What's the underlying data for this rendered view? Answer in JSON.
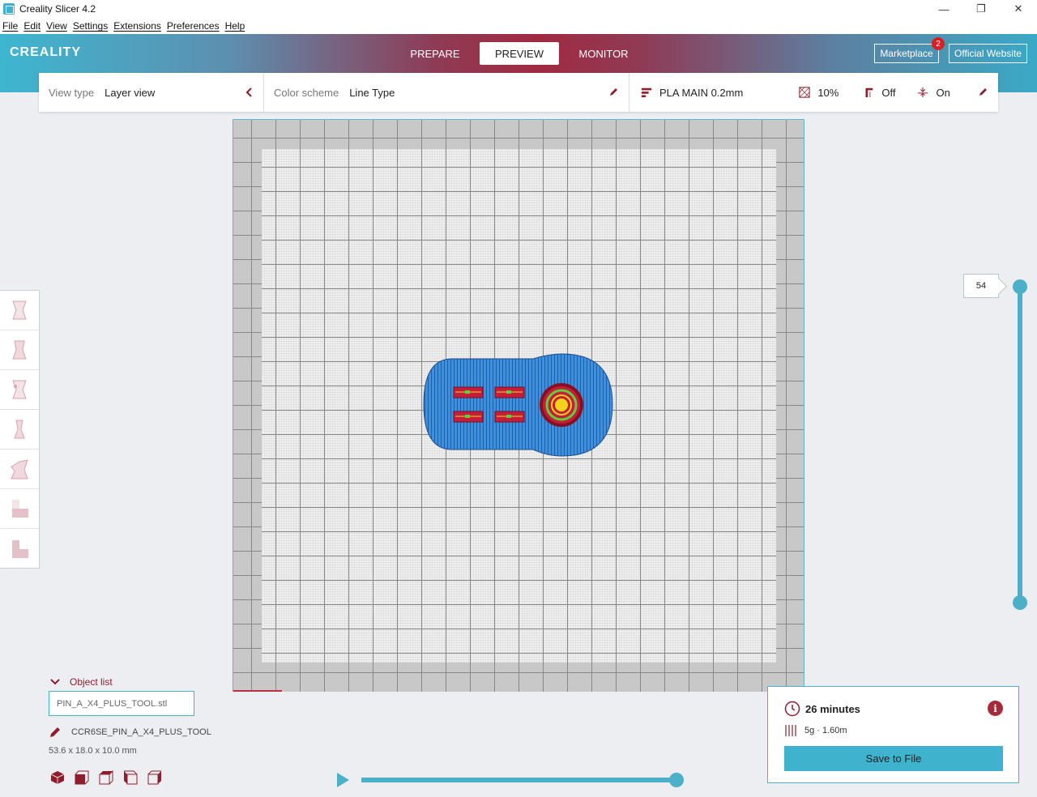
{
  "window": {
    "title": "Creality Slicer 4.2",
    "minimize": "—",
    "maximize": "❐",
    "close": "✕"
  },
  "menu": [
    "File",
    "Edit",
    "View",
    "Settings",
    "Extensions",
    "Preferences",
    "Help"
  ],
  "header": {
    "logo": "CREALITY",
    "tabs": [
      "PREPARE",
      "PREVIEW",
      "MONITOR"
    ],
    "active_tab": "PREVIEW",
    "marketplace_label": "Marketplace",
    "marketplace_badge": "2",
    "website_label": "Official Website"
  },
  "settings_bar": {
    "view_type_label": "View type",
    "view_type_value": "Layer view",
    "color_scheme_label": "Color scheme",
    "color_scheme_value": "Line Type",
    "profile": "PLA MAIN 0.2mm",
    "infill": "10%",
    "support": "Off",
    "adhesion": "On"
  },
  "layer_slider": {
    "current_layer": "54"
  },
  "object_list": {
    "toggle_label": "Object list",
    "file_name": "PIN_A_X4_PLUS_TOOL.stl",
    "object_name": "CCR6SE_PIN_A_X4_PLUS_TOOL",
    "dimensions": "53.6 x 18.0 x 10.0 mm"
  },
  "output": {
    "print_time": "26 minutes",
    "material": "5g · 1.60m",
    "save_label": "Save to File"
  },
  "colors": {
    "accent": "#4bb0c8",
    "brand_red": "#a02a42",
    "model_blue": "#3d8fe0"
  }
}
